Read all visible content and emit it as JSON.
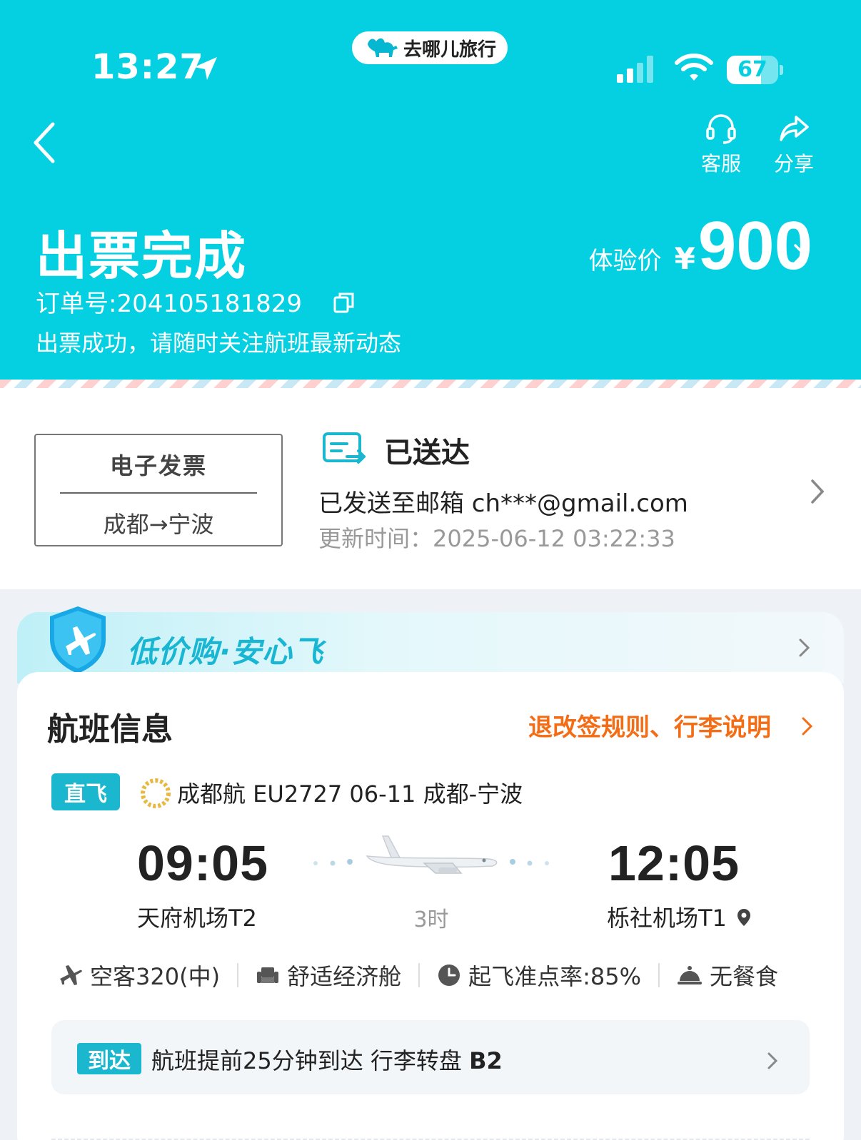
{
  "status_bar": {
    "time": "13:27",
    "brand": "去哪儿旅行",
    "battery": "67",
    "battery_level": 0.67
  },
  "header": {
    "actions": [
      {
        "label": "客服",
        "icon": "headset-icon"
      },
      {
        "label": "分享",
        "icon": "share-icon"
      }
    ],
    "title": "出票完成",
    "price_label": "体验价",
    "price_currency": "¥",
    "price_value": "900",
    "order_no": "订单号:204105181829",
    "subtitle": "出票成功，请随时关注航班最新动态"
  },
  "invoice": {
    "ticket_title": "电子发票",
    "route": "成都→宁波",
    "status": "已送达",
    "sent_to": "已发送至邮箱 ch***@gmail.com",
    "updated": "更新时间：2025-06-12 03:22:33"
  },
  "promo": {
    "text": "低价购·安心飞"
  },
  "flight": {
    "section_title": "航班信息",
    "rules_link": "退改签规则、行李说明",
    "direct_badge": "直飞",
    "flight_line": "成都航 EU2727   06-11 成都-宁波",
    "dep_time": "09:05",
    "dep_airport": "天府机场T2",
    "duration": "3时",
    "arr_time": "12:05",
    "arr_airport": "栎社机场T1",
    "amenities": [
      {
        "label": "空客320(中)",
        "icon": "plane-icon"
      },
      {
        "label": "舒适经济舱",
        "icon": "seat-icon"
      },
      {
        "label": "起飞准点率:85%",
        "icon": "clock-icon"
      },
      {
        "label": "无餐食",
        "icon": "meal-icon"
      }
    ],
    "arrival_badge": "到达",
    "arrival_text": "航班提前25分钟到达 行李转盘",
    "arrival_carousel": "B2"
  },
  "colors": {
    "brand": "#05d0e2",
    "accent_orange": "#f36d16",
    "badge": "#1bb7cf"
  }
}
